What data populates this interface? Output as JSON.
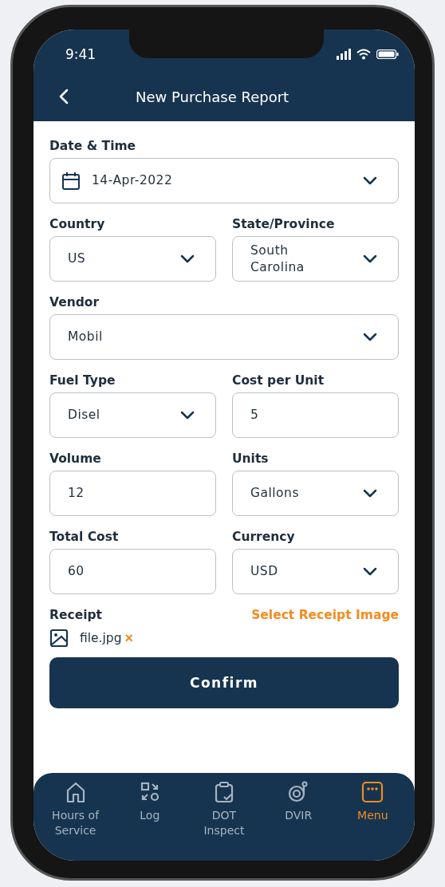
{
  "status_bar": {
    "time": "9:41"
  },
  "header": {
    "title": "New Purchase Report"
  },
  "form": {
    "rows": [
      {
        "fields": [
          {
            "kind": "date",
            "label": "Date & Time",
            "value": "14-Apr-2022"
          }
        ]
      },
      {
        "fields": [
          {
            "kind": "select",
            "label": "Country",
            "value": "US"
          },
          {
            "kind": "select",
            "label": "State/Province",
            "value": "South Carolina"
          }
        ]
      },
      {
        "fields": [
          {
            "kind": "select",
            "label": "Vendor",
            "value": "Mobil"
          }
        ]
      },
      {
        "fields": [
          {
            "kind": "select",
            "label": "Fuel Type",
            "value": "Disel"
          },
          {
            "kind": "input",
            "label": "Cost per Unit",
            "value": "5"
          }
        ]
      },
      {
        "fields": [
          {
            "kind": "input",
            "label": "Volume",
            "value": "12"
          },
          {
            "kind": "select",
            "label": "Units",
            "value": "Gallons"
          }
        ]
      },
      {
        "fields": [
          {
            "kind": "input",
            "label": "Total Cost",
            "value": "60"
          },
          {
            "kind": "select",
            "label": "Currency",
            "value": "USD"
          }
        ]
      }
    ],
    "receipt": {
      "label": "Receipt",
      "action": "Select Receipt Image",
      "file": "file.jpg",
      "remove": "×"
    },
    "confirm": "Confirm"
  },
  "nav": [
    {
      "kind": "home",
      "label": "Hours of Service",
      "selected": false
    },
    {
      "kind": "log",
      "label": "Log",
      "selected": false
    },
    {
      "kind": "clipboard",
      "label": "DOT Inspect",
      "selected": false
    },
    {
      "kind": "dvir",
      "label": "DVIR",
      "selected": false
    },
    {
      "kind": "menu",
      "label": "Menu",
      "selected": true
    }
  ]
}
